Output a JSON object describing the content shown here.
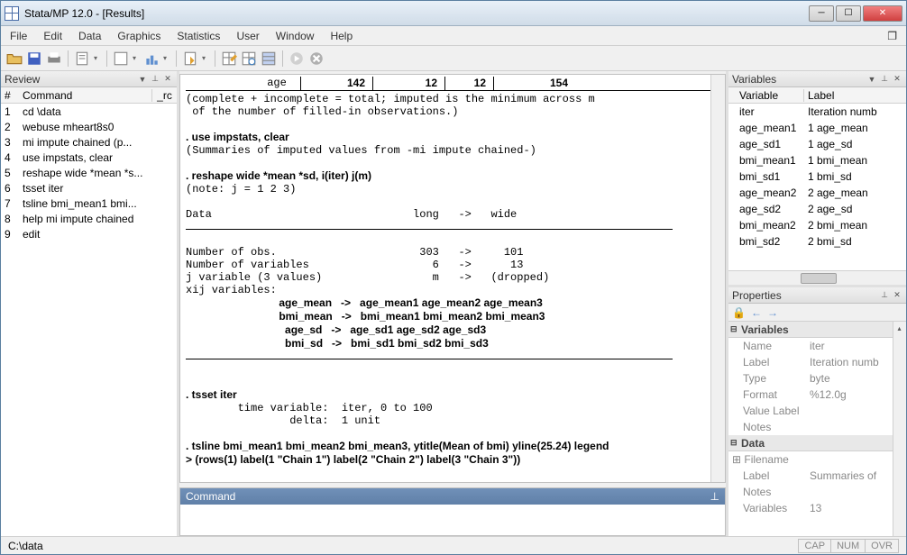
{
  "window": {
    "title": "Stata/MP 12.0 - [Results]"
  },
  "menu": {
    "items": [
      "File",
      "Edit",
      "Data",
      "Graphics",
      "Statistics",
      "User",
      "Window",
      "Help"
    ]
  },
  "review": {
    "title": "Review",
    "columns": {
      "num": "#",
      "cmd": "Command",
      "rc": "_rc"
    },
    "rows": [
      {
        "n": "1",
        "c": "cd \\data"
      },
      {
        "n": "2",
        "c": "webuse mheart8s0"
      },
      {
        "n": "3",
        "c": "mi impute chained (p..."
      },
      {
        "n": "4",
        "c": "use impstats, clear"
      },
      {
        "n": "5",
        "c": "reshape wide *mean *s..."
      },
      {
        "n": "6",
        "c": "tsset iter"
      },
      {
        "n": "7",
        "c": "tsline bmi_mean1 bmi..."
      },
      {
        "n": "8",
        "c": "help mi impute chained"
      },
      {
        "n": "9",
        "c": "edit"
      }
    ]
  },
  "results": {
    "table_header": {
      "label": "age",
      "v1": "142",
      "v2": "12",
      "v3": "12",
      "v4": "154"
    },
    "lines": [
      "(complete + incomplete = total; imputed is the minimum across m",
      " of the number of filled-in observations.)",
      "",
      ". use impstats, clear",
      "(Summaries of imputed values from -mi impute chained-)",
      "",
      ". reshape wide *mean *sd, i(iter) j(m)",
      "(note: j = 1 2 3)",
      "",
      "Data                               long   ->   wide",
      "",
      "Number of obs.                      303   ->     101",
      "Number of variables                   6   ->      13",
      "j variable (3 values)                 m   ->   (dropped)",
      "xij variables:",
      "                               age_mean   ->   age_mean1 age_mean2 age_mean3",
      "                               bmi_mean   ->   bmi_mean1 bmi_mean2 bmi_mean3",
      "                                 age_sd   ->   age_sd1 age_sd2 age_sd3",
      "                                 bmi_sd   ->   bmi_sd1 bmi_sd2 bmi_sd3",
      "",
      "",
      ". tsset iter",
      "        time variable:  iter, 0 to 100",
      "                delta:  1 unit",
      "",
      ". tsline bmi_mean1 bmi_mean2 bmi_mean3, ytitle(Mean of bmi) yline(25.24) legend",
      "> (rows(1) label(1 \"Chain 1\") label(2 \"Chain 2\") label(3 \"Chain 3\"))",
      ""
    ],
    "hr1_after": 9,
    "hr2_after": 18
  },
  "command": {
    "title": "Command",
    "value": ""
  },
  "variables": {
    "title": "Variables",
    "columns": {
      "name": "Variable",
      "label": "Label"
    },
    "rows": [
      {
        "name": "iter",
        "label": "Iteration numb"
      },
      {
        "name": "age_mean1",
        "label": "1 age_mean"
      },
      {
        "name": "age_sd1",
        "label": "1 age_sd"
      },
      {
        "name": "bmi_mean1",
        "label": "1 bmi_mean"
      },
      {
        "name": "bmi_sd1",
        "label": "1 bmi_sd"
      },
      {
        "name": "age_mean2",
        "label": "2 age_mean"
      },
      {
        "name": "age_sd2",
        "label": "2 age_sd"
      },
      {
        "name": "bmi_mean2",
        "label": "2 bmi_mean"
      },
      {
        "name": "bmi_sd2",
        "label": "2 bmi_sd"
      }
    ]
  },
  "properties": {
    "title": "Properties",
    "groups": {
      "variables": {
        "title": "Variables",
        "rows": [
          {
            "k": "Name",
            "v": "iter"
          },
          {
            "k": "Label",
            "v": "Iteration numb"
          },
          {
            "k": "Type",
            "v": "byte"
          },
          {
            "k": "Format",
            "v": "%12.0g"
          },
          {
            "k": "Value Label",
            "v": ""
          },
          {
            "k": "Notes",
            "v": ""
          }
        ]
      },
      "data": {
        "title": "Data",
        "rows": [
          {
            "k": "Filename",
            "v": ""
          },
          {
            "k": "Label",
            "v": "Summaries of"
          },
          {
            "k": "Notes",
            "v": ""
          },
          {
            "k": "Variables",
            "v": "13"
          }
        ]
      }
    }
  },
  "statusbar": {
    "path": "C:\\data",
    "caps": "CAP",
    "num": "NUM",
    "ovr": "OVR"
  }
}
